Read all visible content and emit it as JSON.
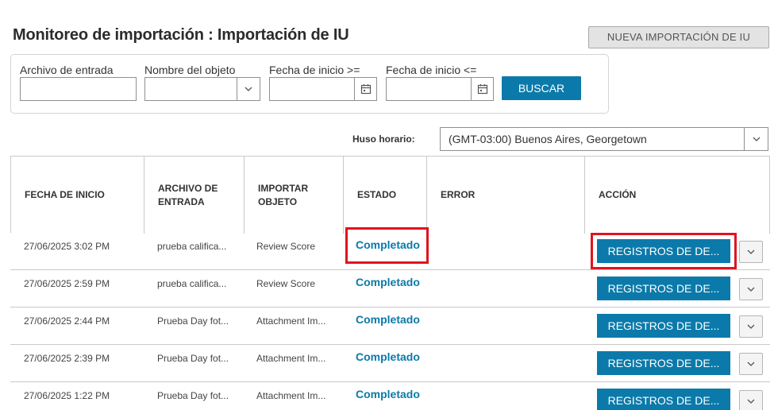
{
  "page": {
    "title": "Monitoreo de importación : Importación de IU",
    "new_import_label": "NUEVA IMPORTACIÓN DE IU"
  },
  "filters": {
    "input_file_label": "Archivo de entrada",
    "input_file_value": "",
    "object_name_label": "Nombre del objeto",
    "object_name_value": "",
    "start_from_label": "Fecha de inicio >=",
    "start_from_value": "",
    "start_to_label": "Fecha de inicio <=",
    "start_to_value": "",
    "search_label": "BUSCAR"
  },
  "timezone": {
    "label": "Huso horario:",
    "value": "(GMT-03:00) Buenos Aires, Georgetown"
  },
  "table": {
    "headers": {
      "start_date": "FECHA DE INICIO",
      "input_file": "ARCHIVO DE ENTRADA",
      "import_object": "IMPORTAR OBJETO",
      "status": "ESTADO",
      "error": "ERROR",
      "action": "ACCIÓN"
    },
    "rows": [
      {
        "start": "27/06/2025 3:02 PM",
        "file": "prueba califica...",
        "object": "Review Score",
        "status": "Completado",
        "error": "",
        "action": "REGISTROS DE DE..."
      },
      {
        "start": "27/06/2025 2:59 PM",
        "file": "prueba califica...",
        "object": "Review Score",
        "status": "Completado",
        "error": "",
        "action": "REGISTROS DE DE..."
      },
      {
        "start": "27/06/2025 2:44 PM",
        "file": "Prueba Day fot...",
        "object": "Attachment Im...",
        "status": "Completado",
        "error": "",
        "action": "REGISTROS DE DE..."
      },
      {
        "start": "27/06/2025 2:39 PM",
        "file": "Prueba Day fot...",
        "object": "Attachment Im...",
        "status": "Completado",
        "error": "",
        "action": "REGISTROS DE DE..."
      },
      {
        "start": "27/06/2025 1:22 PM",
        "file": "Prueba Day fot...",
        "object": "Attachment Im...",
        "status": "Completado",
        "error": "",
        "action": "REGISTROS DE DE..."
      }
    ]
  },
  "icons": {
    "select_arrow": "chevron-down-icon",
    "date_picker": "calendar-icon",
    "row_menu": "chevron-down-icon"
  },
  "colors": {
    "accent": "#0b7aaa",
    "highlight": "#e0141e"
  }
}
